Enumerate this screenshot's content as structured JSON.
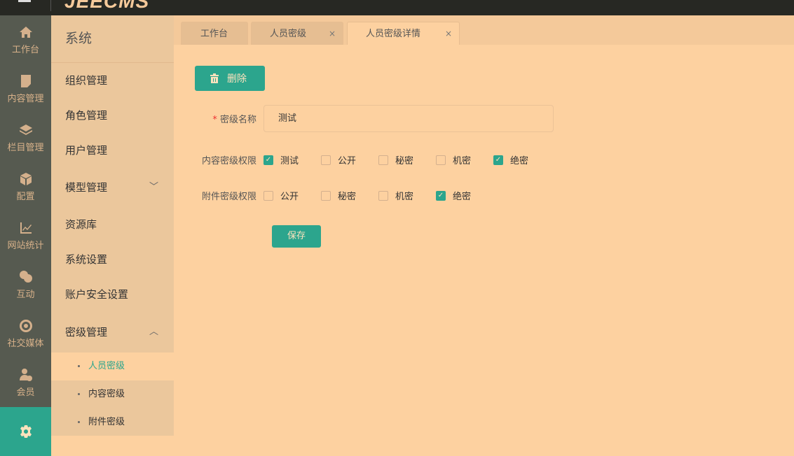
{
  "header": {
    "logo": "JEECMS"
  },
  "iconbar": [
    {
      "label": "工作台",
      "icon": "home-icon"
    },
    {
      "label": "内容管理",
      "icon": "document-icon"
    },
    {
      "label": "栏目管理",
      "icon": "layers-icon"
    },
    {
      "label": "配置",
      "icon": "box-icon"
    },
    {
      "label": "网站统计",
      "icon": "chart-icon"
    },
    {
      "label": "互动",
      "icon": "chat-icon"
    },
    {
      "label": "社交媒体",
      "icon": "social-icon"
    },
    {
      "label": "会员",
      "icon": "member-icon"
    },
    {
      "label": "",
      "icon": "gear-icon"
    }
  ],
  "submenu": {
    "title": "系统",
    "items": [
      "组织管理",
      "角色管理",
      "用户管理",
      "模型管理",
      "资源库",
      "系统设置",
      "账户安全设置",
      "密级管理"
    ],
    "subitems": [
      "人员密级",
      "内容密级",
      "附件密级"
    ]
  },
  "tabs": [
    "工作台",
    "人员密级",
    "人员密级详情"
  ],
  "form": {
    "delete_label": "删除",
    "name_label": "密级名称",
    "name_value": "测试",
    "content_label": "内容密级权限",
    "content_options": [
      {
        "label": "测试",
        "checked": true
      },
      {
        "label": "公开",
        "checked": false
      },
      {
        "label": "秘密",
        "checked": false
      },
      {
        "label": "机密",
        "checked": false
      },
      {
        "label": "绝密",
        "checked": true
      }
    ],
    "attach_label": "附件密级权限",
    "attach_options": [
      {
        "label": "公开",
        "checked": false
      },
      {
        "label": "秘密",
        "checked": false
      },
      {
        "label": "机密",
        "checked": false
      },
      {
        "label": "绝密",
        "checked": true
      }
    ],
    "save_label": "保存"
  },
  "colors": {
    "accent": "#2ca58d",
    "topbar": "#272823",
    "iconbar": "#565a50"
  }
}
